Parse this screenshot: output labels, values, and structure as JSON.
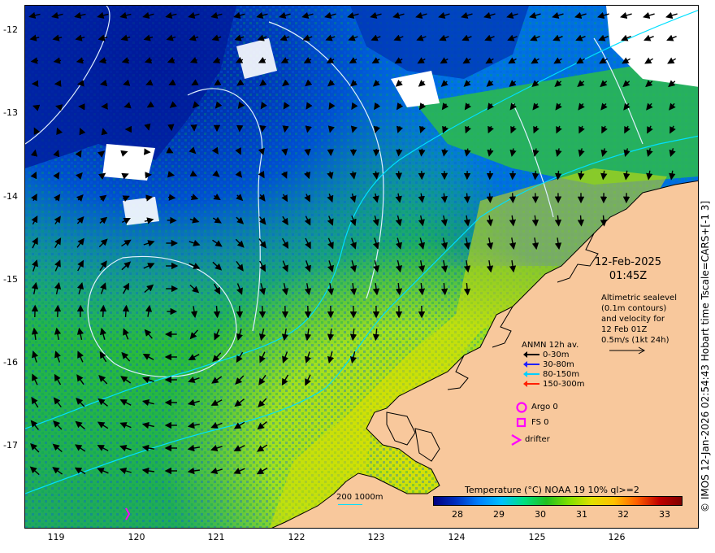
{
  "map": {
    "y_axis_ticks": [
      "-12",
      "-13",
      "-14",
      "-15",
      "-16",
      "-17"
    ],
    "x_axis_ticks": [
      "119",
      "120",
      "121",
      "122",
      "123",
      "124",
      "125",
      "126"
    ],
    "land_color": "#f8c89c",
    "missing_color": "#ffffff"
  },
  "date_block": {
    "date": "12-Feb-2025",
    "time": "01:45Z"
  },
  "altimetry_text": {
    "line1": "Altimetric sealevel",
    "line2": "(0.1m contours)",
    "line3": "and velocity for",
    "line4": "12 Feb 01Z",
    "line5": "0.5m/s (1kt 24h)"
  },
  "anmn_legend": {
    "title": "ANMN 12h av.",
    "rows": [
      {
        "label": "0-30m",
        "color": "#000000"
      },
      {
        "label": "30-80m",
        "color": "#2020ff"
      },
      {
        "label": "80-150m",
        "color": "#00d0ff"
      },
      {
        "label": "150-300m",
        "color": "#ff2000"
      }
    ]
  },
  "markers_legend": {
    "argo": "Argo 0",
    "fs": "FS 0",
    "drifter": "drifter",
    "color": "#ff00ff"
  },
  "contour_legend": {
    "label": "200  1000m",
    "color": "#00e0ff"
  },
  "colorbar": {
    "title": "Temperature (°C) NOAA 19 10% ql>=2",
    "ticks": [
      "28",
      "29",
      "30",
      "31",
      "32",
      "33"
    ],
    "range": [
      27.5,
      33.5
    ],
    "colors": [
      "#000080",
      "#0030c0",
      "#0080ff",
      "#00c0ff",
      "#00e080",
      "#20c020",
      "#80e000",
      "#e0e000",
      "#ffc000",
      "#ff6000",
      "#c00000",
      "#800000"
    ]
  },
  "copyright": "© IMOS 12-Jan-2026 02:54:43 Hobart time Tscale=CARS+[-1 3]"
}
